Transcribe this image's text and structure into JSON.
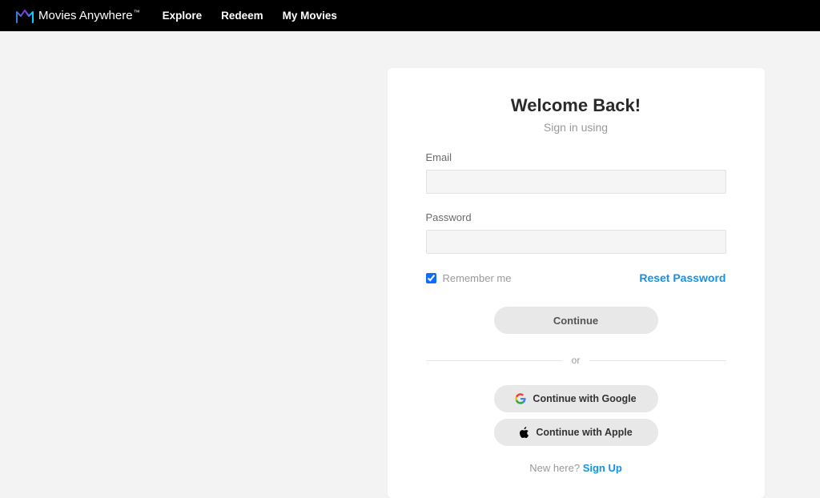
{
  "header": {
    "brand": "Movies Anywhere",
    "nav": {
      "explore": "Explore",
      "redeem": "Redeem",
      "myMovies": "My Movies"
    }
  },
  "signin": {
    "title": "Welcome Back!",
    "subtitle": "Sign in using",
    "emailLabel": "Email",
    "emailValue": "",
    "passwordLabel": "Password",
    "passwordValue": "",
    "rememberLabel": "Remember me",
    "rememberChecked": true,
    "resetPassword": "Reset Password",
    "continueLabel": "Continue",
    "dividerText": "or",
    "googleLabel": "Continue with Google",
    "appleLabel": "Continue with Apple",
    "signupPrefix": "New here? ",
    "signupLink": "Sign Up"
  }
}
